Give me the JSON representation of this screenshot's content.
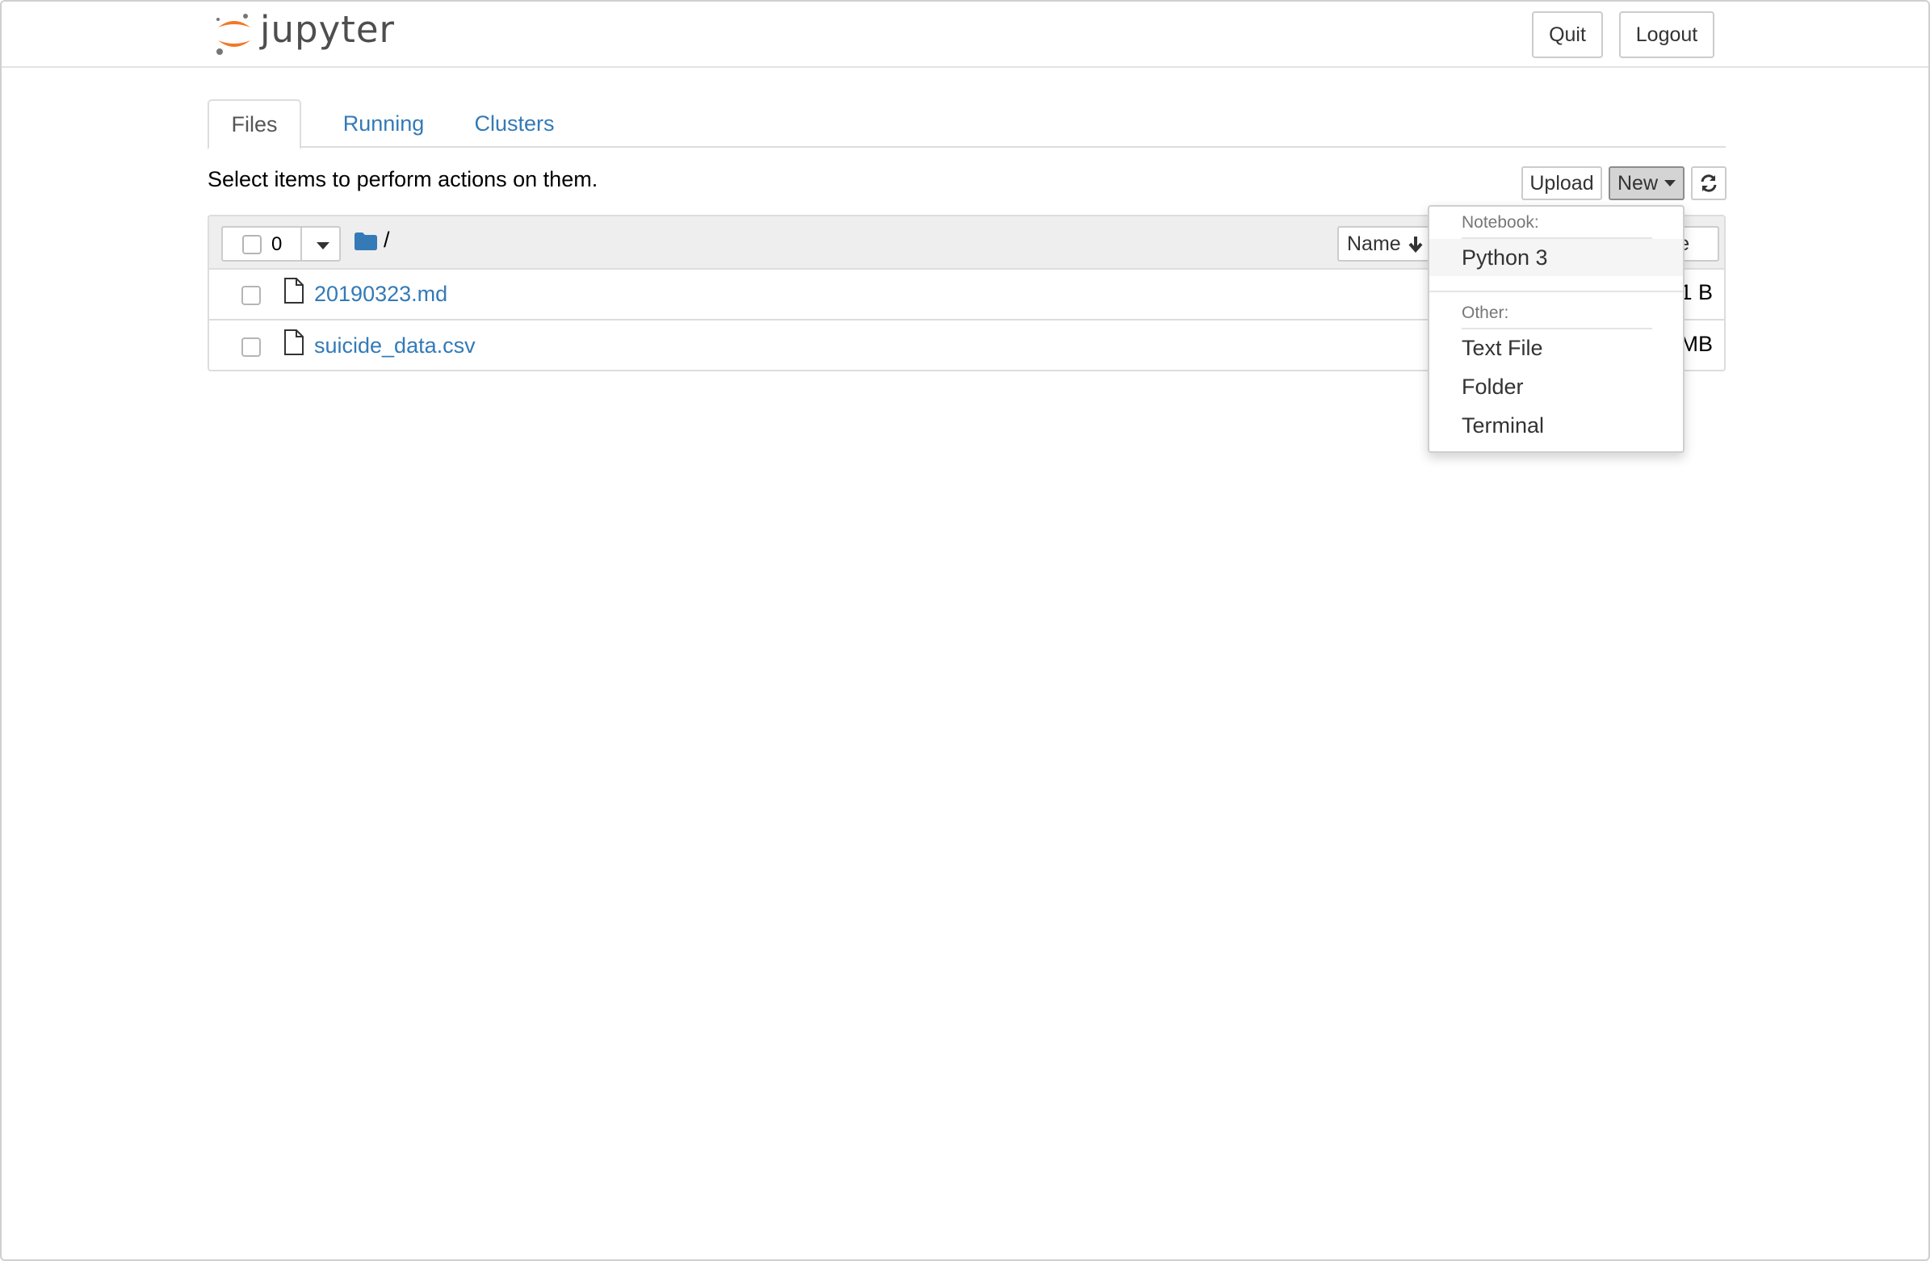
{
  "header": {
    "logo_text": "jupyter",
    "quit_label": "Quit",
    "logout_label": "Logout"
  },
  "tabs": [
    {
      "label": "Files",
      "active": true
    },
    {
      "label": "Running",
      "active": false
    },
    {
      "label": "Clusters",
      "active": false
    }
  ],
  "toolbar": {
    "hint": "Select items to perform actions on them.",
    "upload_label": "Upload",
    "new_label": "New"
  },
  "list": {
    "selected_count": "0",
    "breadcrumb": "/",
    "name_sort_label": "Name",
    "size_label_partial": "ze",
    "files": [
      {
        "name": "20190323.md",
        "size_partial": "1 B"
      },
      {
        "name": "suicide_data.csv",
        "size_partial": "MB"
      }
    ]
  },
  "new_menu": {
    "notebook_header": "Notebook:",
    "python": "Python 3",
    "other_header": "Other:",
    "text_file": "Text File",
    "folder": "Folder",
    "terminal": "Terminal"
  },
  "colors": {
    "link": "#337ab7",
    "logo_orange": "#f37726",
    "border": "#dddddd"
  }
}
